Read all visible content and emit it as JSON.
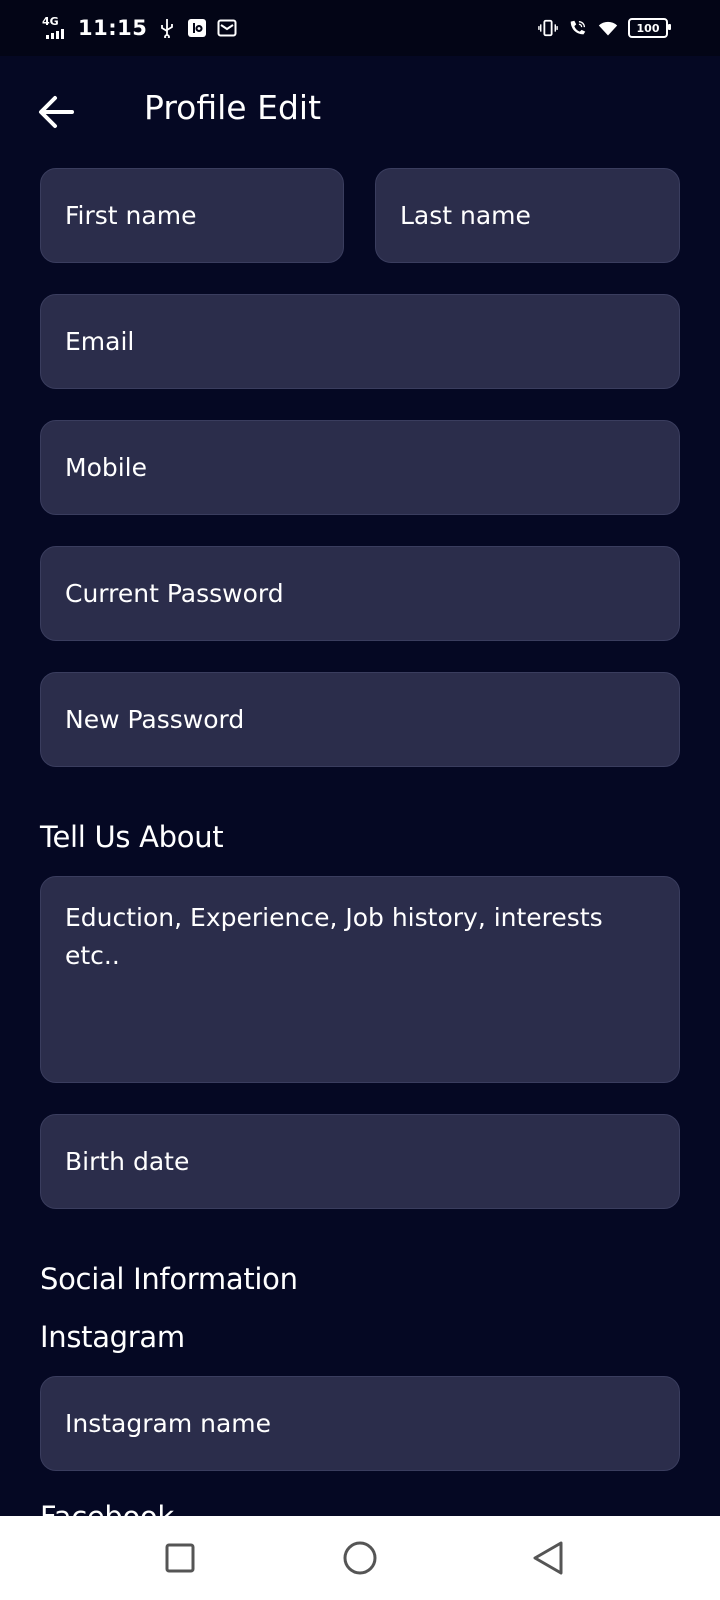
{
  "status_bar": {
    "network": "4G",
    "time": "11:15",
    "battery": "100"
  },
  "header": {
    "title": "Profile Edit"
  },
  "form": {
    "first_name_placeholder": "First name",
    "last_name_placeholder": "Last name",
    "email_placeholder": "Email",
    "mobile_placeholder": "Mobile",
    "current_password_placeholder": "Current Password",
    "new_password_placeholder": "New Password",
    "about_label": "Tell Us About",
    "about_placeholder": "Eduction, Experience, Job history, interests etc..",
    "birth_date_placeholder": "Birth date",
    "social_label": "Social Information",
    "instagram_label": "Instagram",
    "instagram_placeholder": "Instagram name",
    "facebook_label": "Facebook"
  },
  "colors": {
    "background": "#050823",
    "field": "#2b2d4b",
    "text": "#ffffff"
  }
}
